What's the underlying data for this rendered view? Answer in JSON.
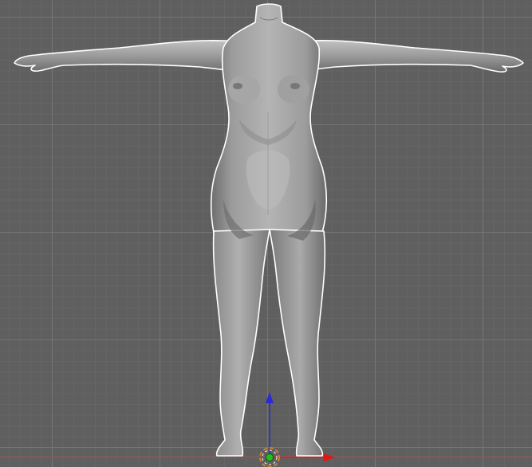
{
  "viewport": {
    "background_color": "#5f5f5f",
    "grid_color": "#787878",
    "model_color": "#9a9a9a",
    "outline_color": "#ffffff",
    "axis_x_color": "#e01818",
    "axis_z_color": "#2828e0",
    "origin_color": "#20c020",
    "cursor_color": "#d08030",
    "selection_outline": "on",
    "icons": [
      "3d-cursor-icon",
      "origin-point-icon",
      "transform-gizmo-icon"
    ]
  }
}
